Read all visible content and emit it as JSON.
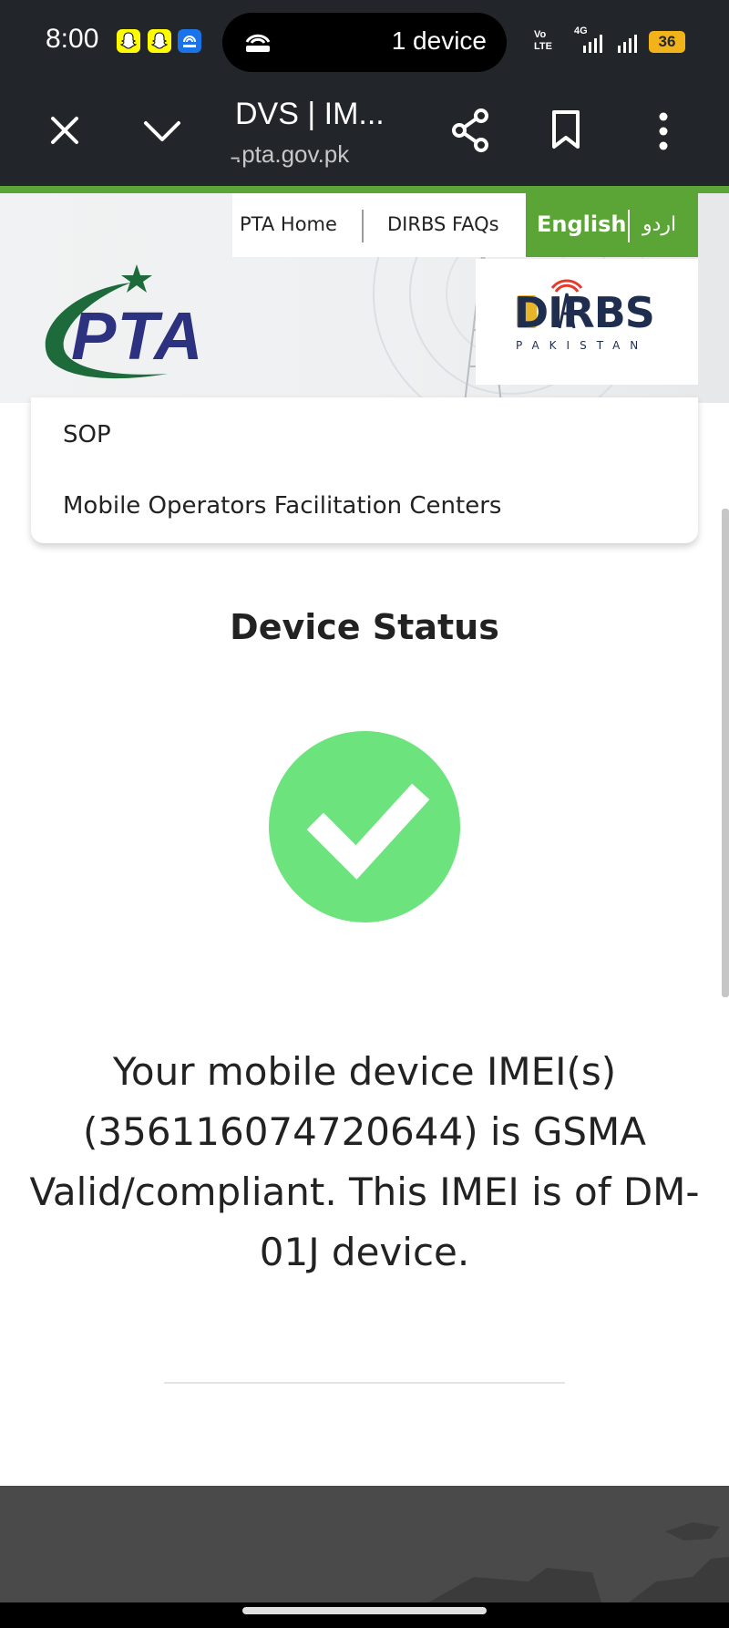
{
  "status_bar": {
    "time": "8:00",
    "pill_text": "1 device",
    "battery": "36",
    "network_label": "4G",
    "volte_label": "Vo LTE"
  },
  "browser": {
    "title": "DVS | IM...",
    "url": "̵.pta.gov.pk"
  },
  "top_nav": {
    "home": "PTA Home",
    "faqs": "DIRBS FAQs",
    "lang_en": "English",
    "lang_ur": "اردو"
  },
  "logos": {
    "pta": "PTA",
    "dirbs": "DIRBS",
    "dirbs_sub": "PAKISTAN"
  },
  "menu": {
    "items": [
      "SOP",
      "Mobile Operators Facilitation Centers"
    ]
  },
  "main": {
    "heading": "Device Status",
    "message": "Your mobile device IMEI(s) (356116074720644) is GSMA Valid/compliant. This IMEI is of DM-01J device."
  },
  "colors": {
    "brand_green": "#5aa536",
    "success_green": "#6ce37c",
    "pta_blue": "#2c3180",
    "pta_green": "#1d6b3a",
    "status_bg": "#22262b"
  }
}
